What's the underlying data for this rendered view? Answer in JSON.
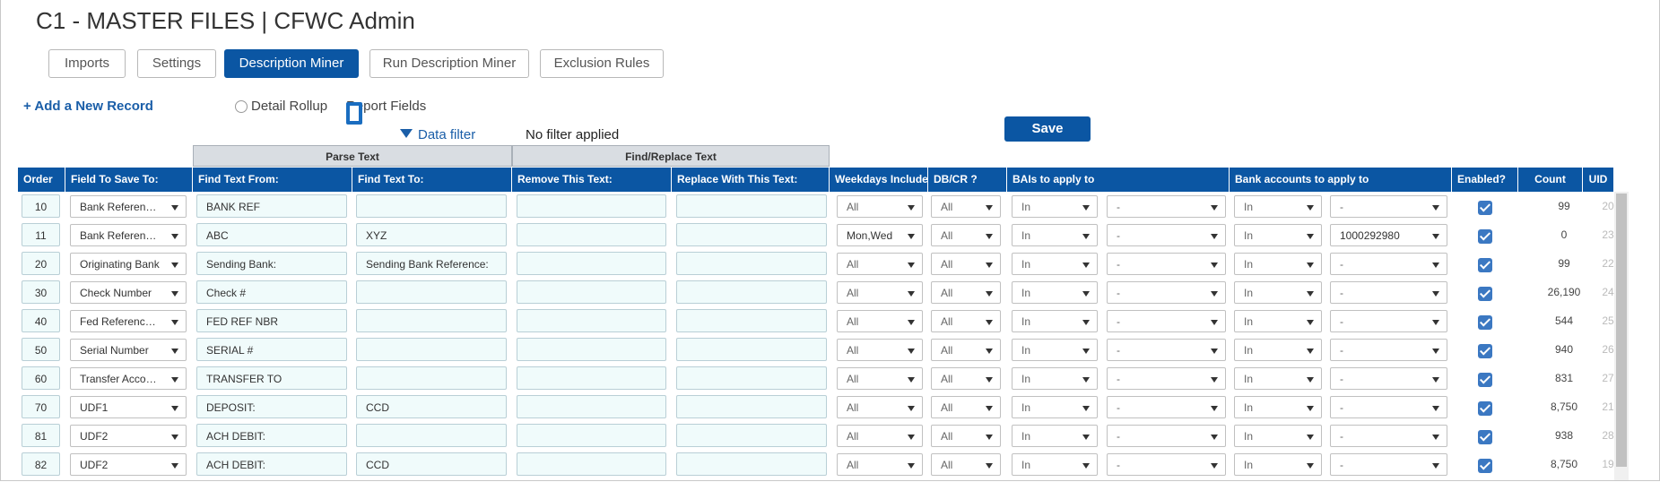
{
  "app": {
    "title": "C1 - MASTER FILES | CFWC Admin"
  },
  "tabs": [
    {
      "label": "Imports",
      "active": false
    },
    {
      "label": "Settings",
      "active": false
    },
    {
      "label": "Description Miner",
      "active": true
    },
    {
      "label": "Run Description Miner",
      "active": false
    },
    {
      "label": "Exclusion Rules",
      "active": false
    }
  ],
  "toolbar": {
    "add_record": "+ Add a New Record",
    "radio_detail": "Detail Rollup",
    "radio_report": "Report Fields",
    "data_filter": "Data filter",
    "filter_status": "No filter applied",
    "save_label": "Save"
  },
  "groups": {
    "parse": "Parse Text",
    "replace": "Find/Replace Text"
  },
  "columns": {
    "order": "Order",
    "field": "Field To Save To:",
    "find_from": "Find Text From:",
    "find_to": "Find Text To:",
    "remove": "Remove This Text:",
    "replace": "Replace With This Text:",
    "weekdays": "Weekdays Included",
    "dbcr": "DB/CR ?",
    "bais": "BAIs to apply to",
    "banks": "Bank accounts to apply to",
    "enabled": "Enabled?",
    "count": "Count",
    "uid": "UID"
  },
  "rows": [
    {
      "order": "10",
      "field": "Bank Reference Number",
      "find_from": "BANK REF",
      "find_to": "",
      "remove": "",
      "replace": "",
      "weekdays": "All",
      "dbcr": "All",
      "bai_mode": "In",
      "bai_value": "-",
      "bank_mode": "In",
      "bank_value": "-",
      "enabled": true,
      "count": "99",
      "uid": "20"
    },
    {
      "order": "11",
      "field": "Bank Reference Number",
      "find_from": "ABC",
      "find_to": "XYZ",
      "remove": "",
      "replace": "",
      "weekdays": "Mon,Wed",
      "dbcr": "All",
      "bai_mode": "In",
      "bai_value": "-",
      "bank_mode": "In",
      "bank_value": "1000292980",
      "enabled": true,
      "count": "0",
      "uid": "23"
    },
    {
      "order": "20",
      "field": "Originating Bank",
      "find_from": "Sending Bank:",
      "find_to": "Sending Bank Reference:",
      "remove": "",
      "replace": "",
      "weekdays": "All",
      "dbcr": "All",
      "bai_mode": "In",
      "bai_value": "-",
      "bank_mode": "In",
      "bank_value": "-",
      "enabled": true,
      "count": "99",
      "uid": "22"
    },
    {
      "order": "30",
      "field": "Check Number",
      "find_from": "Check #",
      "find_to": "",
      "remove": "",
      "replace": "",
      "weekdays": "All",
      "dbcr": "All",
      "bai_mode": "In",
      "bai_value": "-",
      "bank_mode": "In",
      "bank_value": "-",
      "enabled": true,
      "count": "26,190",
      "uid": "24"
    },
    {
      "order": "40",
      "field": "Fed Reference Number",
      "find_from": "FED REF NBR",
      "find_to": "",
      "remove": "",
      "replace": "",
      "weekdays": "All",
      "dbcr": "All",
      "bai_mode": "In",
      "bai_value": "-",
      "bank_mode": "In",
      "bank_value": "-",
      "enabled": true,
      "count": "544",
      "uid": "25"
    },
    {
      "order": "50",
      "field": "Serial Number",
      "find_from": "SERIAL #",
      "find_to": "",
      "remove": "",
      "replace": "",
      "weekdays": "All",
      "dbcr": "All",
      "bai_mode": "In",
      "bai_value": "-",
      "bank_mode": "In",
      "bank_value": "-",
      "enabled": true,
      "count": "940",
      "uid": "26"
    },
    {
      "order": "60",
      "field": "Transfer Account",
      "find_from": "TRANSFER TO",
      "find_to": "",
      "remove": "",
      "replace": "",
      "weekdays": "All",
      "dbcr": "All",
      "bai_mode": "In",
      "bai_value": "-",
      "bank_mode": "In",
      "bank_value": "-",
      "enabled": true,
      "count": "831",
      "uid": "27"
    },
    {
      "order": "70",
      "field": "UDF1",
      "find_from": "DEPOSIT:",
      "find_to": "CCD",
      "remove": "",
      "replace": "",
      "weekdays": "All",
      "dbcr": "All",
      "bai_mode": "In",
      "bai_value": "-",
      "bank_mode": "In",
      "bank_value": "-",
      "enabled": true,
      "count": "8,750",
      "uid": "21"
    },
    {
      "order": "81",
      "field": "UDF2",
      "find_from": "ACH DEBIT:",
      "find_to": "",
      "remove": "",
      "replace": "",
      "weekdays": "All",
      "dbcr": "All",
      "bai_mode": "In",
      "bai_value": "-",
      "bank_mode": "In",
      "bank_value": "-",
      "enabled": true,
      "count": "938",
      "uid": "28"
    },
    {
      "order": "82",
      "field": "UDF2",
      "find_from": "ACH DEBIT:",
      "find_to": "CCD",
      "remove": "",
      "replace": "",
      "weekdays": "All",
      "dbcr": "All",
      "bai_mode": "In",
      "bai_value": "-",
      "bank_mode": "In",
      "bank_value": "-",
      "enabled": true,
      "count": "8,750",
      "uid": "19"
    }
  ]
}
